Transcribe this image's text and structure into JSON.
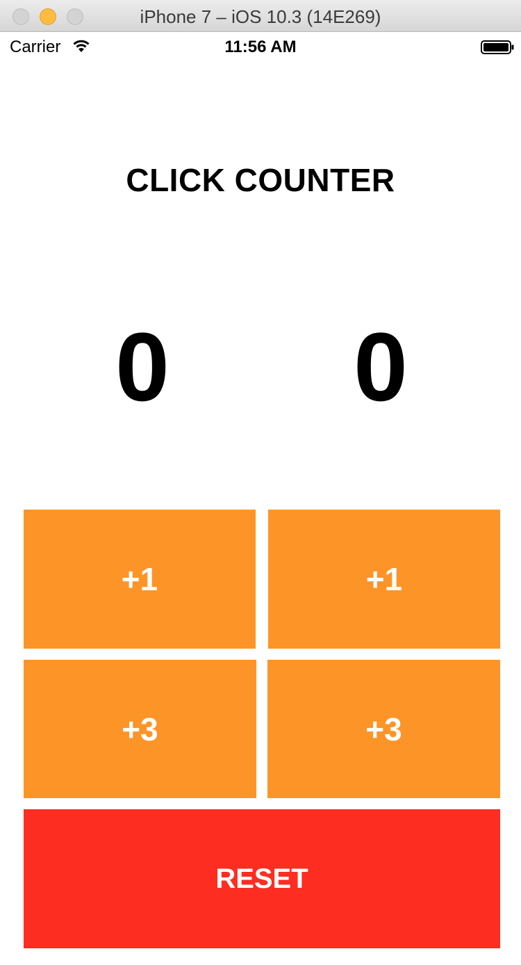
{
  "window": {
    "title": "iPhone 7 – iOS 10.3 (14E269)"
  },
  "status_bar": {
    "carrier": "Carrier",
    "time": "11:56 AM",
    "icons": [
      "wifi-icon",
      "battery-icon"
    ]
  },
  "app": {
    "title": "CLICK COUNTER",
    "counters": {
      "left": "0",
      "right": "0"
    },
    "buttons": {
      "left_plus_one": "+1",
      "right_plus_one": "+1",
      "left_plus_three": "+3",
      "right_plus_three": "+3",
      "reset": "RESET"
    }
  },
  "colors": {
    "increment_button": "#fd9428",
    "reset_button": "#fd2d22",
    "button_text": "#ffffff",
    "minimize_traffic_light": "#fdbc40"
  }
}
